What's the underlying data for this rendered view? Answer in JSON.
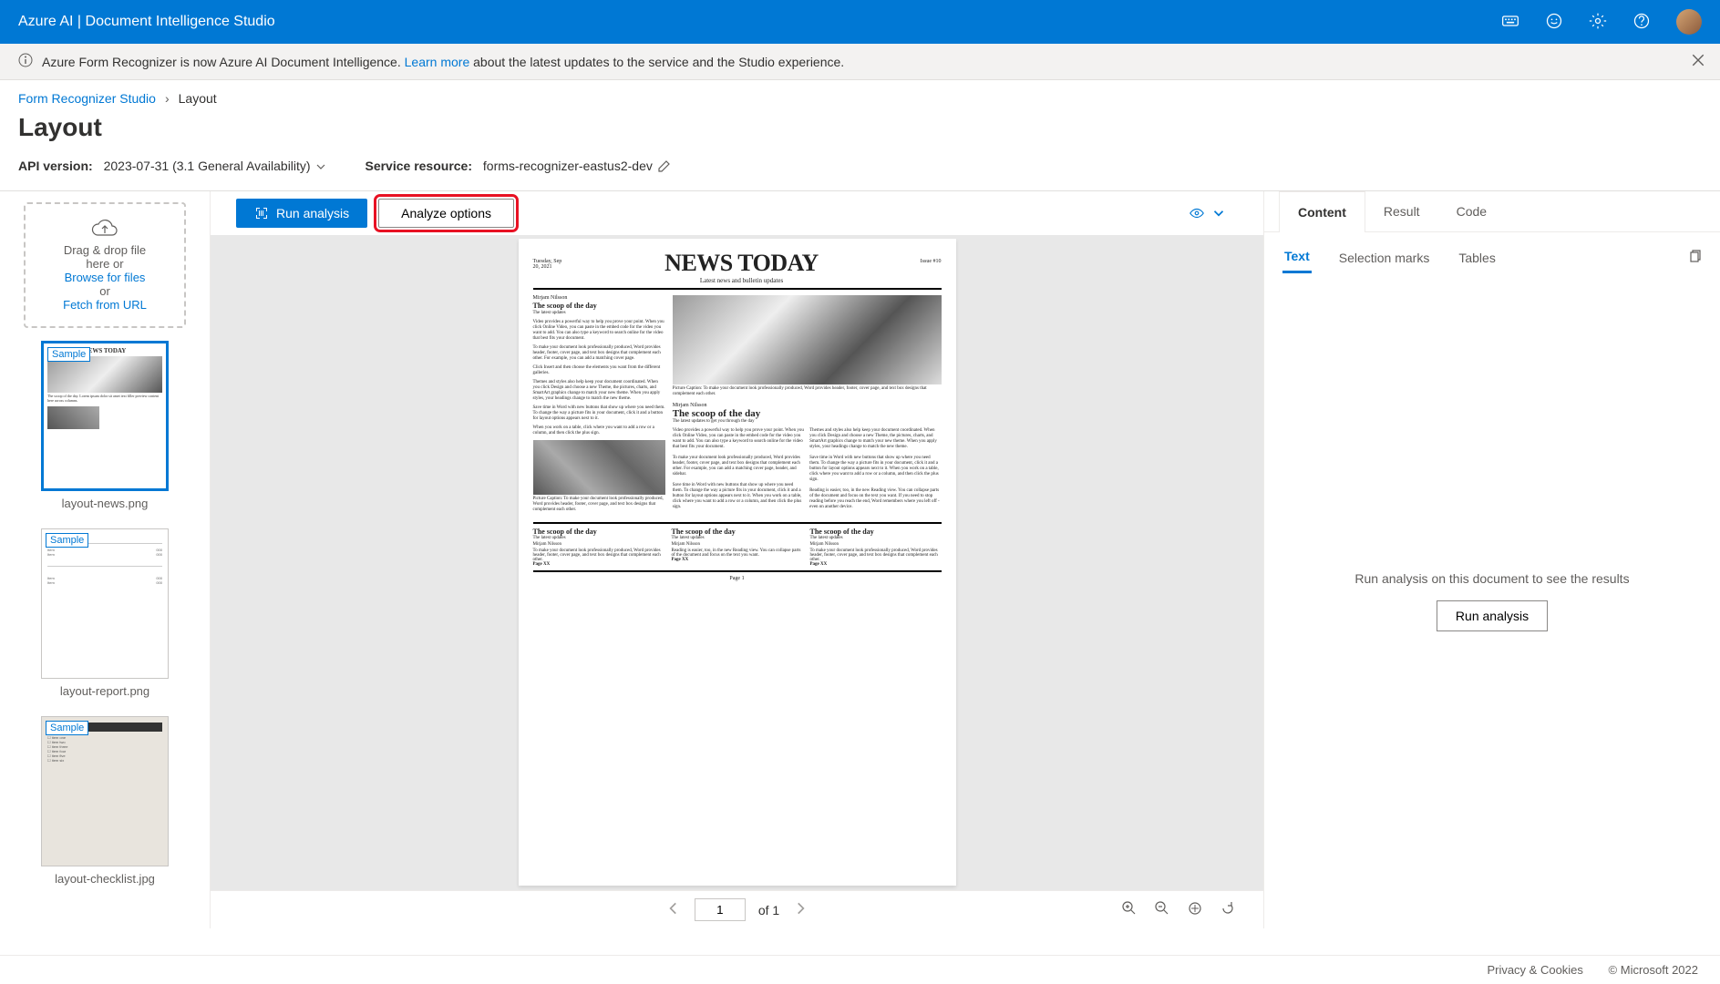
{
  "header": {
    "title": "Azure AI | Document Intelligence Studio"
  },
  "notice": {
    "text_before": "Azure Form Recognizer is now Azure AI Document Intelligence. ",
    "link": "Learn more",
    "text_after": " about the latest updates to the service and the Studio experience."
  },
  "breadcrumb": {
    "parent": "Form Recognizer Studio",
    "current": "Layout"
  },
  "page_title": "Layout",
  "config": {
    "api_label": "API version:",
    "api_value": "2023-07-31 (3.1 General Availability)",
    "resource_label": "Service resource:",
    "resource_value": "forms-recognizer-eastus2-dev"
  },
  "dropzone": {
    "line1": "Drag & drop file",
    "line2": "here or",
    "browse": "Browse for files",
    "or": "or",
    "fetch": "Fetch from URL"
  },
  "thumbs": {
    "t1": {
      "tag": "Sample",
      "label": "layout-news.png"
    },
    "t2": {
      "tag": "Sample",
      "label": "layout-report.png"
    },
    "t3": {
      "tag": "Sample",
      "label": "layout-checklist.jpg"
    }
  },
  "toolbar": {
    "run": "Run analysis",
    "options": "Analyze options"
  },
  "paginator": {
    "current": "1",
    "of": "of 1"
  },
  "result_tabs": {
    "content": "Content",
    "result": "Result",
    "code": "Code"
  },
  "sub_tabs": {
    "text": "Text",
    "marks": "Selection marks",
    "tables": "Tables"
  },
  "right": {
    "msg": "Run analysis on this document to see the results",
    "btn": "Run analysis"
  },
  "footer": {
    "privacy": "Privacy & Cookies",
    "copy": "© Microsoft 2022"
  },
  "doc": {
    "date": "Tuesday, Sep 20, 2021",
    "title": "NEWS TODAY",
    "subtitle": "Latest news and bulletin updates",
    "issue": "Issue #10",
    "author": "Mirjam Nilsson",
    "h2": "The scoop of the day",
    "sub2": "The latest updates",
    "sub3": "The latest updates to get you through the day",
    "page": "Page XX",
    "pg1": "Page 1"
  }
}
